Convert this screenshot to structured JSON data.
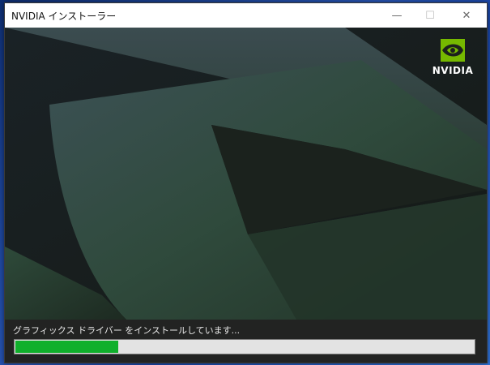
{
  "window": {
    "title": "NVIDIA インストーラー",
    "controls": {
      "minimize_icon": "minimize-icon",
      "maximize_icon": "maximize-icon",
      "close_icon": "close-icon"
    }
  },
  "banner": {
    "logo_icon": "nvidia-eye-icon",
    "logo_text": "NVIDIA"
  },
  "install": {
    "status_text": "グラフィックス ドライバー をインストールしています...",
    "progress_fraction": 0.225,
    "progress_color": "#0fb02b"
  }
}
